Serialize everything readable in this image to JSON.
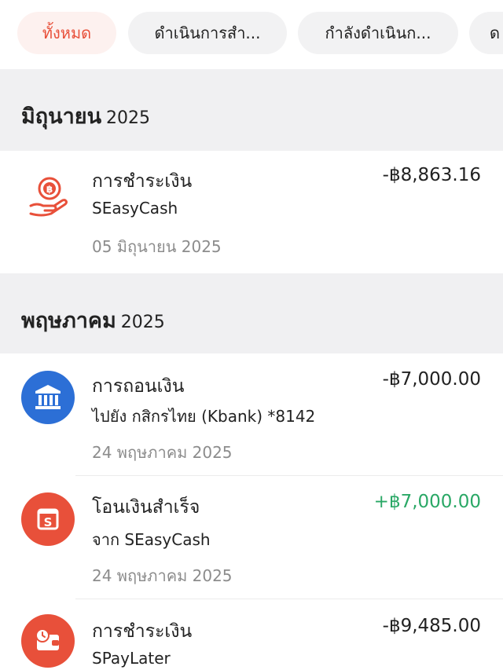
{
  "filters": {
    "chips": [
      {
        "label": "ทั้งหมด",
        "active": true
      },
      {
        "label": "ดำเนินการสำ...",
        "active": false
      },
      {
        "label": "กำลังดำเนินก...",
        "active": false
      },
      {
        "label": "ด",
        "active": false
      }
    ]
  },
  "sections": [
    {
      "month": "มิถุนายน",
      "year": "2025",
      "transactions": [
        {
          "title": "การชำระเงิน",
          "subtitle": "SEasyCash",
          "date": "05 มิถุนายน 2025",
          "amount": "-฿8,863.16",
          "direction": "out",
          "icon": "hand-coin-icon",
          "icon_color": "#e8503a"
        }
      ]
    },
    {
      "month": "พฤษภาคม",
      "year": "2025",
      "transactions": [
        {
          "title": "การถอนเงิน",
          "subtitle": "ไปยัง กสิกรไทย (Kbank) *8142",
          "date": "24 พฤษภาคม 2025",
          "amount": "-฿7,000.00",
          "direction": "out",
          "icon": "bank-icon",
          "icon_color": "#2c6fd6"
        },
        {
          "title": "โอนเงินสำเร็จ",
          "subtitle": "จาก SEasyCash",
          "date": "24 พฤษภาคม 2025",
          "amount": "+฿7,000.00",
          "direction": "in",
          "icon": "wallet-s-icon",
          "icon_color": "#e8503a"
        },
        {
          "title": "การชำระเงิน",
          "subtitle": "SPayLater",
          "date": "",
          "amount": "-฿9,485.00",
          "direction": "out",
          "icon": "wallet-clock-icon",
          "icon_color": "#e8503a"
        }
      ]
    }
  ]
}
